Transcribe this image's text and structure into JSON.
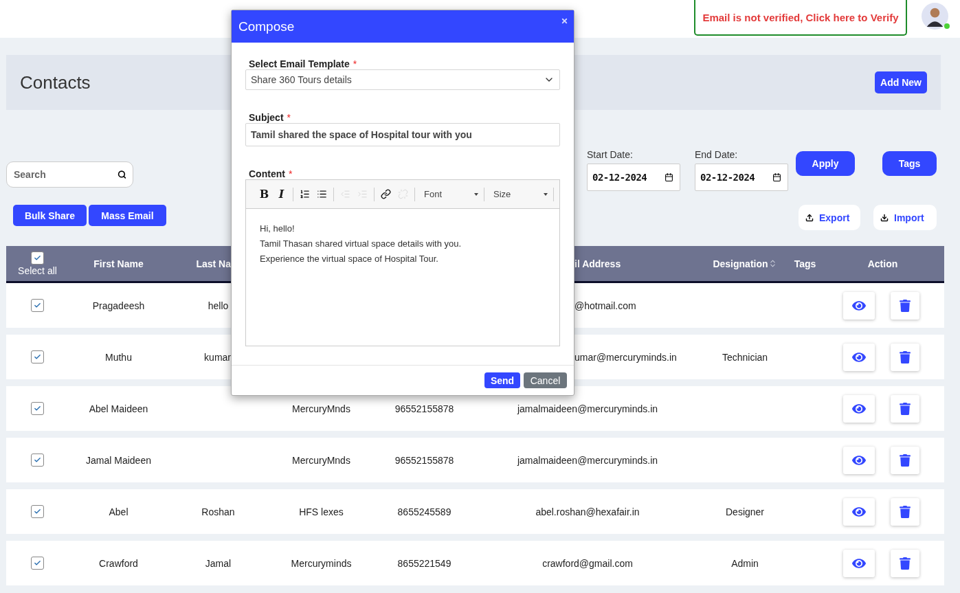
{
  "topbar": {
    "verify_notice": "Email is not verified, Click here to Verify",
    "user_online": true
  },
  "page": {
    "title": "Contacts",
    "add_button": "Add New"
  },
  "search": {
    "placeholder": "Search"
  },
  "bulk_actions": [
    "Bulk Share",
    "Mass Email"
  ],
  "date_filter": {
    "start_label": "Start Date:",
    "start_value": "02-12-2024",
    "end_label": "End Date:",
    "end_value": "02-12-2024",
    "apply": "Apply"
  },
  "tags_button": "Tags",
  "export_button": "Export",
  "import_button": "Import",
  "table": {
    "select_all": {
      "label": "Select all",
      "checked": true
    },
    "header": {
      "first_name": {
        "text": "First Name"
      },
      "last_name": {
        "text": "Last Na",
        "clipped": true
      },
      "email": {
        "text": "il Address",
        "clipped": true
      },
      "designation": {
        "text": "Designation",
        "sortable": true
      },
      "tags": {
        "text": "Tags"
      },
      "action": {
        "text": "Action"
      }
    },
    "rows": [
      {
        "checked": true,
        "first_name": "Pragadeesh",
        "last_name": "hello",
        "email": {
          "text": "@hotmail.com",
          "clipped": true
        }
      },
      {
        "checked": true,
        "first_name": "Muthu",
        "last_name": {
          "text": "kumar",
          "clipped": true
        },
        "email": {
          "text": "umar@mercuryminds.in",
          "clipped": true
        },
        "designation": "Technician"
      },
      {
        "checked": true,
        "first_name": "Abel Maideen",
        "company": "MercuryMnds",
        "phone": "96552155878",
        "email": "jamalmaideen@mercuryminds.in"
      },
      {
        "checked": true,
        "first_name": "Jamal Maideen",
        "company": "MercuryMnds",
        "phone": "96552155878",
        "email": "jamalmaideen@mercuryminds.in"
      },
      {
        "checked": true,
        "first_name": "Abel",
        "last_name": "Roshan",
        "company": "HFS lexes",
        "phone": "8655245589",
        "email": "abel.roshan@hexafair.in",
        "designation": "Designer"
      },
      {
        "checked": true,
        "first_name": "Crawford",
        "last_name": "Jamal",
        "company": "Mercuryminds",
        "phone": "8655221549",
        "email": "crawford@gmail.com",
        "designation": "Admin"
      }
    ]
  },
  "compose": {
    "title": "Compose",
    "template": {
      "label": "Select Email Template",
      "mark": "*",
      "value": "Share 360 Tours details"
    },
    "subject": {
      "label": "Subject",
      "mark": "*",
      "value": "Tamil shared the space of Hospital tour with you"
    },
    "content": {
      "label": "Content",
      "mark": "*",
      "toolbar": [
        {
          "kind": "bold",
          "text": "B",
          "disabled": false
        },
        {
          "kind": "italic",
          "text": "I",
          "disabled": false
        },
        {
          "kind": "separator"
        },
        {
          "kind": "numbered",
          "disabled": false
        },
        {
          "kind": "bulleted",
          "disabled": false
        },
        {
          "kind": "separator"
        },
        {
          "kind": "outdent",
          "disabled": true
        },
        {
          "kind": "indent",
          "disabled": true
        },
        {
          "kind": "separator"
        },
        {
          "kind": "link",
          "disabled": false
        },
        {
          "kind": "unlink",
          "disabled": true
        },
        {
          "kind": "separator"
        },
        {
          "kind": "dropdown",
          "text": "Font"
        },
        {
          "kind": "separator"
        },
        {
          "kind": "dropdown",
          "text": "Size"
        },
        {
          "kind": "separator"
        }
      ],
      "lines": [
        "Hi, hello!",
        "Tamil Thasan shared virtual space details with you.",
        "Experience the virtual space of Hospital Tour."
      ]
    },
    "send": "Send",
    "cancel": "Cancel"
  }
}
